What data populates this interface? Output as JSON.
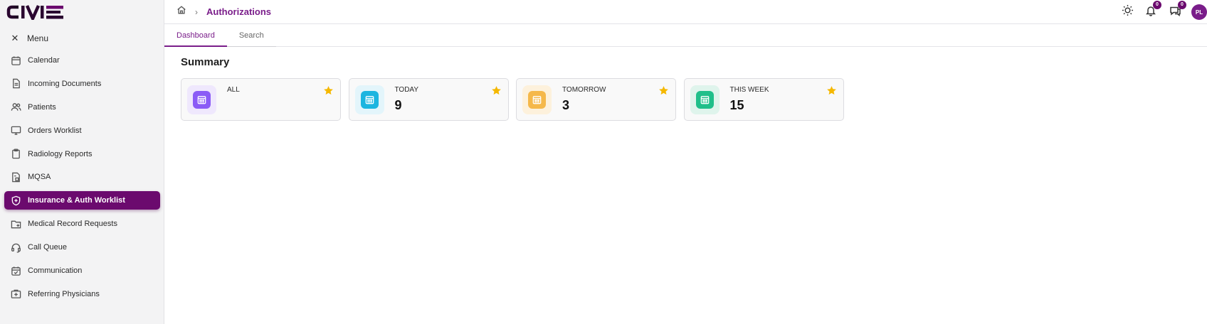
{
  "brand": {
    "logo_text": "CIVIE"
  },
  "sidebar": {
    "menu_label": "Menu",
    "items": [
      {
        "label": "Calendar",
        "icon": "calendar-icon"
      },
      {
        "label": "Incoming Documents",
        "icon": "document-icon"
      },
      {
        "label": "Patients",
        "icon": "users-icon"
      },
      {
        "label": "Orders Worklist",
        "icon": "monitor-icon"
      },
      {
        "label": "Radiology Reports",
        "icon": "clipboard-icon"
      },
      {
        "label": "MQSA",
        "icon": "file-icon"
      },
      {
        "label": "Insurance & Auth Worklist",
        "icon": "shield-icon",
        "active": true
      },
      {
        "label": "Medical Record Requests",
        "icon": "folder-plus-icon"
      },
      {
        "label": "Call Queue",
        "icon": "headset-icon"
      },
      {
        "label": "Communication",
        "icon": "calendar-check-icon"
      },
      {
        "label": "Referring Physicians",
        "icon": "medical-case-icon"
      }
    ]
  },
  "header": {
    "breadcrumb_title": "Authorizations",
    "notifications_count": "0",
    "messages_count": "0",
    "avatar_initials": "PL"
  },
  "tabs": [
    {
      "label": "Dashboard",
      "active": true
    },
    {
      "label": "Search",
      "active": false
    }
  ],
  "summary": {
    "title": "Summary",
    "cards": [
      {
        "label": "ALL",
        "count": "",
        "color": "#8b5cf6",
        "bg": "#efe8fd"
      },
      {
        "label": "TODAY",
        "count": "9",
        "color": "#1cb5e0",
        "bg": "#e3f5fb"
      },
      {
        "label": "TOMORROW",
        "count": "3",
        "color": "#f5b84a",
        "bg": "#fdf1dc"
      },
      {
        "label": "THIS WEEK",
        "count": "15",
        "color": "#20bf8a",
        "bg": "#dff4ec"
      }
    ]
  },
  "colors": {
    "accent": "#6b0a6e",
    "star": "#f5b800"
  }
}
